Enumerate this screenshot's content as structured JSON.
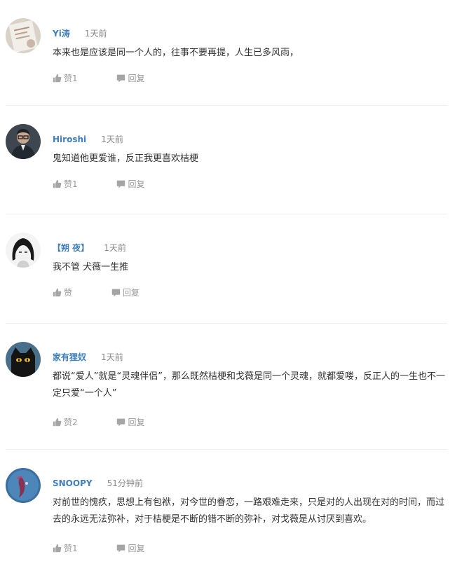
{
  "comments": [
    {
      "username": "Yi涛",
      "time": "1天前",
      "content": "本来也是应该是同一个人的，往事不要再提，人生已多风雨，",
      "like_label": "赞1",
      "reply_label": "回复",
      "avatar_icon": "photo-of-paper-avatar"
    },
    {
      "username": "Hiroshi",
      "time": "1天前",
      "content": "鬼知道他更爱谁，反正我更喜欢桔梗",
      "like_label": "赞1",
      "reply_label": "回复",
      "avatar_icon": "man-with-glasses-avatar"
    },
    {
      "username": "【朔 夜】",
      "time": "1天前",
      "content": "我不管 犬薇一生推",
      "like_label": "赞",
      "reply_label": "回复",
      "avatar_icon": "anime-girl-sketch-avatar"
    },
    {
      "username": "家有狸奴",
      "time": "1天前",
      "content": "都说“爱人”就是“灵魂伴侣”，那么既然桔梗和戈薇是同一个灵魂，就都爱喽，反正人的一生也不一定只爱“一个人”",
      "like_label": "赞2",
      "reply_label": "回复",
      "avatar_icon": "black-cat-avatar"
    },
    {
      "username": "SNOOPY",
      "time": "51分钟前",
      "content": "对前世的愧疚，思想上有包袱，对今世的眷恋，一路艰难走来，只是对的人出现在对的时间，而过去的永远无法弥补，对于桔梗是不断的错不断的弥补，对戈薇是从讨厌到喜欢。",
      "like_label": "赞1",
      "reply_label": "回复",
      "avatar_icon": "underwater-creature-avatar"
    }
  ],
  "colors": {
    "username": "#3f7fbf",
    "time": "#888888",
    "action": "#999999",
    "divider": "#eeeeee"
  }
}
